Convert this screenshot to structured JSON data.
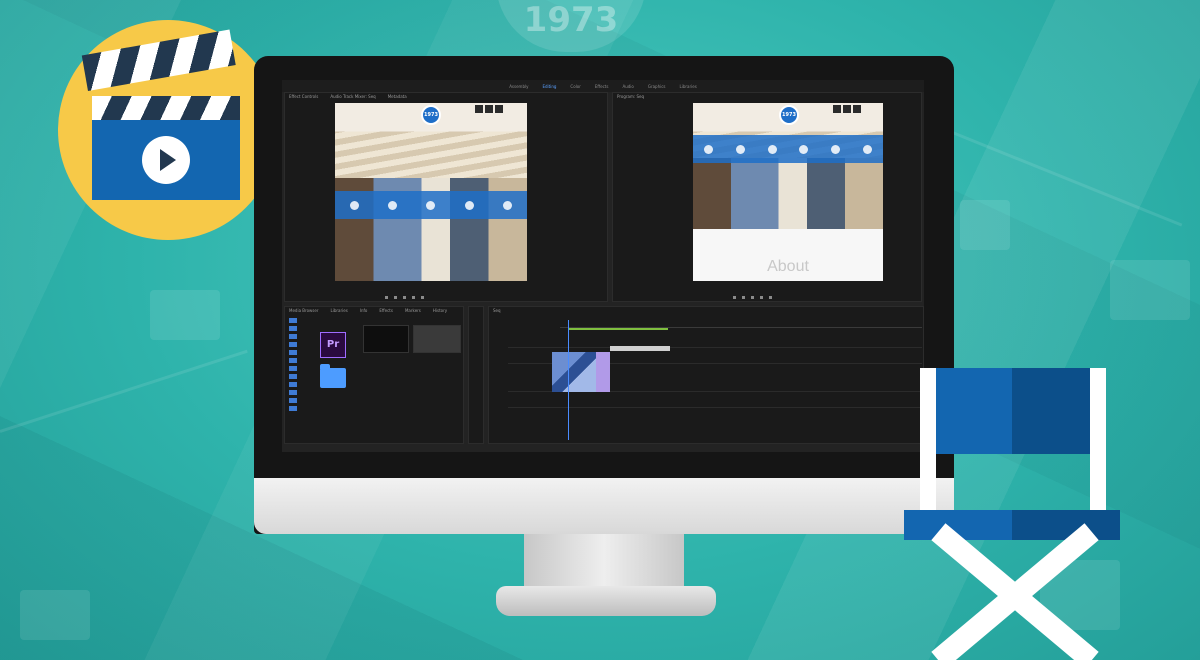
{
  "background": {
    "badge_text": "1973",
    "color": "#2fb5ad"
  },
  "clapper": {
    "icon": "clapperboard-icon",
    "play_icon": "play-icon",
    "circle_color": "#f7c948"
  },
  "premiere": {
    "workspace_tabs": [
      "Assembly",
      "Editing",
      "Color",
      "Effects",
      "Audio",
      "Graphics",
      "Libraries"
    ],
    "active_workspace": "Editing",
    "source_panel": {
      "tabs": [
        "Effect Controls",
        "Audio Track Mixer: Seq",
        "Metadata"
      ]
    },
    "program_panel": {
      "title": "Program: Seq"
    },
    "program_overlay": {
      "pin_label": "1973",
      "about_text": "About"
    },
    "source_overlay": {
      "pin_label": "1973"
    },
    "project_panel": {
      "tabs": [
        "Media Browser",
        "Libraries",
        "Info",
        "Effects",
        "Markers",
        "History"
      ],
      "app_icon_text": "Pr"
    },
    "timeline": {
      "tab_title": "Seq"
    }
  },
  "accent_colors": {
    "premiere_blue": "#4a8cff",
    "clip_purple": "#b19ae8",
    "chair_blue": "#1366b0",
    "chair_dark": "#0c4f8a"
  }
}
